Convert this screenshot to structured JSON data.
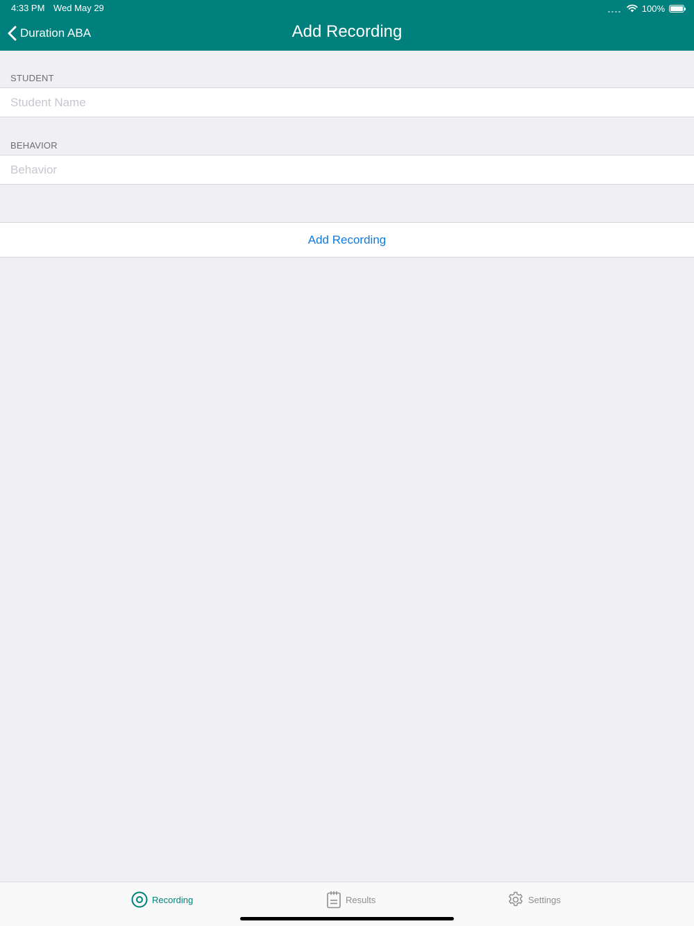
{
  "status_bar": {
    "time": "4:33 PM",
    "date": "Wed May 29",
    "battery": "100%"
  },
  "nav": {
    "back_label": "Duration ABA",
    "title": "Add Recording"
  },
  "form": {
    "student": {
      "header": "STUDENT",
      "value": "",
      "placeholder": "Student Name"
    },
    "behavior": {
      "header": "BEHAVIOR",
      "value": "",
      "placeholder": "Behavior"
    },
    "add_button": "Add Recording"
  },
  "tabs": [
    {
      "label": "Recording",
      "icon": "target-icon",
      "active": true
    },
    {
      "label": "Results",
      "icon": "clipboard-icon",
      "active": false
    },
    {
      "label": "Settings",
      "icon": "gear-icon",
      "active": false
    }
  ],
  "colors": {
    "brand": "#00807c",
    "link": "#127ad8",
    "background": "#efeff4"
  }
}
